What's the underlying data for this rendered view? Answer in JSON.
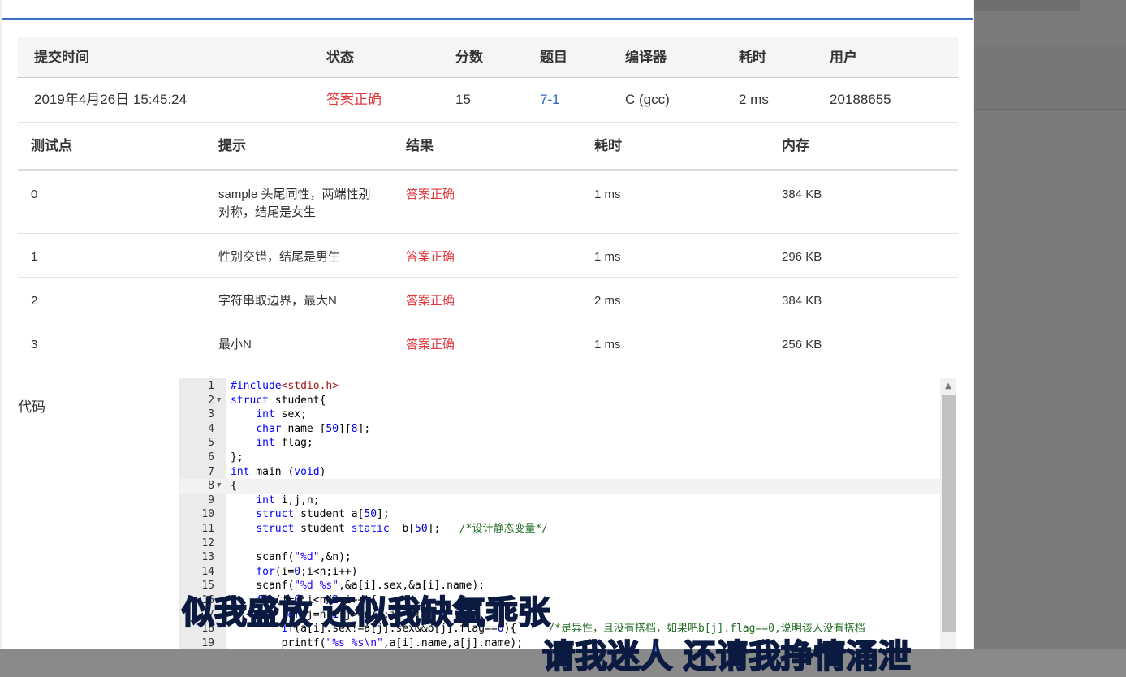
{
  "submission": {
    "headers": [
      "提交时间",
      "状态",
      "分数",
      "题目",
      "编译器",
      "耗时",
      "用户"
    ],
    "row": {
      "time": "2019年4月26日 15:45:24",
      "status": "答案正确",
      "score": "15",
      "problem": "7-1",
      "compiler": "C (gcc)",
      "duration": "2 ms",
      "user": "20188655"
    }
  },
  "tests": {
    "headers": [
      "测试点",
      "提示",
      "结果",
      "耗时",
      "内存"
    ],
    "rows": [
      {
        "id": "0",
        "hint": "sample 头尾同性，两端性别对称，结尾是女生",
        "result": "答案正确",
        "time": "1 ms",
        "memory": "384 KB"
      },
      {
        "id": "1",
        "hint": "性别交错，结尾是男生",
        "result": "答案正确",
        "time": "1 ms",
        "memory": "296 KB"
      },
      {
        "id": "2",
        "hint": "字符串取边界，最大N",
        "result": "答案正确",
        "time": "2 ms",
        "memory": "384 KB"
      },
      {
        "id": "3",
        "hint": "最小N",
        "result": "答案正确",
        "time": "1 ms",
        "memory": "256 KB"
      }
    ]
  },
  "code_label": "代码",
  "code_lines": [
    {
      "n": "1",
      "text": "#include<stdio.h>"
    },
    {
      "n": "2",
      "text": "struct student{",
      "fold": true
    },
    {
      "n": "3",
      "text": "    int sex;"
    },
    {
      "n": "4",
      "text": "    char name [50][8];"
    },
    {
      "n": "5",
      "text": "    int flag;"
    },
    {
      "n": "6",
      "text": "};"
    },
    {
      "n": "7",
      "text": "int main (void)"
    },
    {
      "n": "8",
      "text": "{",
      "fold": true
    },
    {
      "n": "9",
      "text": "    int i,j,n;"
    },
    {
      "n": "10",
      "text": "    struct student a[50];"
    },
    {
      "n": "11",
      "text": "    struct student static  b[50];   /*设计静态变量*/"
    },
    {
      "n": "12",
      "text": ""
    },
    {
      "n": "13",
      "text": "    scanf(\"%d\",&n);"
    },
    {
      "n": "14",
      "text": "    for(i=0;i<n;i++)"
    },
    {
      "n": "15",
      "text": "    scanf(\"%d %s\",&a[i].sex,&a[i].name);"
    },
    {
      "n": "16",
      "text": "    for(i=0;i<n/2;i++){"
    },
    {
      "n": "17",
      "text": "        for(j=n-1;j>=n/2;j--){"
    },
    {
      "n": "18",
      "text": "        if(a[i].sex!=a[j].sex&&b[j].flag==0){     /*是异性，且没有搭档，如果吧b[j].flag==0,说明该人没有搭档"
    },
    {
      "n": "19",
      "text": "        printf(\"%s %s\\n\",a[i].name,a[j].name);"
    }
  ],
  "overlay": {
    "lyric_top": "似我盛放 还似我缺氧乖张",
    "lyric_bottom": "请我迷人 还请我挣情涌泄"
  },
  "colors": {
    "accent_line": "#3a6fc4",
    "status_correct": "#e0393e",
    "problem_link": "#2f66c8"
  }
}
